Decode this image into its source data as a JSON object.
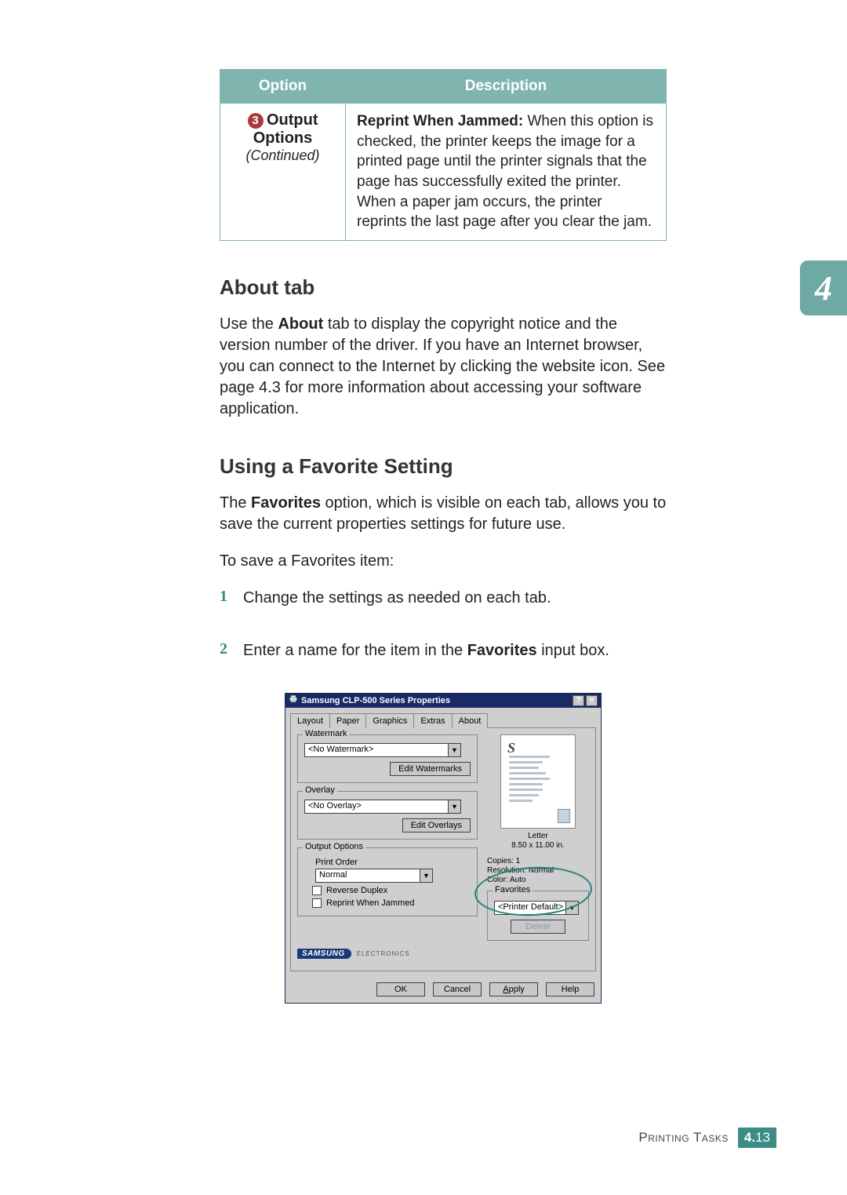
{
  "side_chapter_number": "4",
  "table": {
    "headers": {
      "option": "Option",
      "description": "Description"
    },
    "row": {
      "badge_number": "3",
      "title_line1": "Output",
      "title_line2": "Options",
      "continued": "(Continued)",
      "desc_lead": "Reprint When Jammed:",
      "desc_rest": " When this option is checked, the printer keeps the image for a printed page until the printer signals that the page has successfully exited the printer. When a paper jam occurs, the printer reprints the last page after you clear the jam."
    }
  },
  "sections": {
    "about": {
      "heading": "About tab",
      "p_before": "Use the ",
      "p_bold": "About",
      "p_after": " tab to display the copyright notice and the version number of the driver. If you have an Internet browser, you can connect to the Internet by clicking the website icon. See page 4.3 for more information about accessing your software application."
    },
    "favorite": {
      "heading": "Using a Favorite Setting",
      "p1_before": "The ",
      "p1_bold": "Favorites",
      "p1_after": " option, which is visible on each tab, allows you to save the current properties settings for future use.",
      "p2": "To save a Favorites item:",
      "steps": {
        "s1_num": "1",
        "s1_text": "Change the settings as needed on each tab.",
        "s2_num": "2",
        "s2_before": "Enter a name for the item in the ",
        "s2_bold": "Favorites",
        "s2_after": " input box."
      }
    }
  },
  "dialog": {
    "title": "Samsung CLP-500 Series Properties",
    "help_btn": "?",
    "close_btn": "×",
    "tabs": {
      "layout": "Layout",
      "paper": "Paper",
      "graphics": "Graphics",
      "extras": "Extras",
      "about": "About"
    },
    "groups": {
      "watermark": {
        "legend": "Watermark",
        "value": "<No Watermark>",
        "edit": "Edit Watermarks"
      },
      "overlay": {
        "legend": "Overlay",
        "value": "<No Overlay>",
        "edit": "Edit Overlays"
      },
      "output": {
        "legend": "Output Options",
        "print_order_label": "Print Order",
        "print_order_value": "Normal",
        "reverse_duplex": "Reverse Duplex",
        "reprint_when_jammed": "Reprint When Jammed"
      }
    },
    "preview": {
      "paper_name": "Letter",
      "paper_size": "8.50 x 11.00 in.",
      "copies": "Copies: 1",
      "resolution": "Resolution: Normal",
      "color": "Color: Auto"
    },
    "favorites": {
      "legend": "Favorites",
      "value": "<Printer Default>",
      "delete": "Delete"
    },
    "brand": {
      "name": "SAMSUNG",
      "sub": "ELECTRONICS"
    },
    "footer": {
      "ok": "OK",
      "cancel": "Cancel",
      "apply_u": "A",
      "apply_rest": "pply",
      "help": "Help"
    }
  },
  "page_footer": {
    "label": "Printing Tasks",
    "chapter": "4.",
    "page": "13"
  }
}
